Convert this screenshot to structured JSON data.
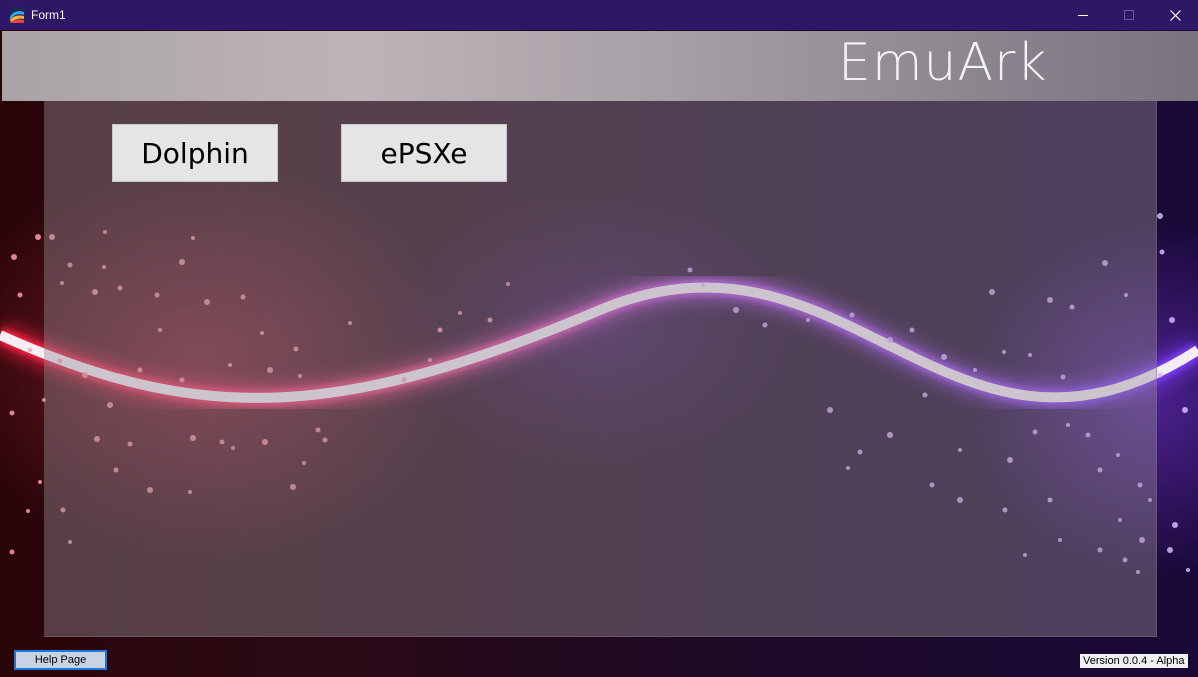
{
  "window": {
    "title": "Form1",
    "controls": {
      "minimize": "—",
      "maximize": "☐",
      "close": "✕"
    }
  },
  "header": {
    "logo": "EmuArk"
  },
  "emulators": [
    {
      "label": "Dolphin"
    },
    {
      "label": "ePSXe"
    }
  ],
  "footer": {
    "help_label": "Help Page",
    "version": "Version 0.0.4 - Alpha"
  },
  "colors": {
    "titlebar": "#2e1766",
    "wave_left": "#ff3050",
    "wave_right": "#9040ff",
    "button_face": "#e5e5e5",
    "help_border": "#1e78d6"
  },
  "icons": {
    "app": "app-icon"
  }
}
